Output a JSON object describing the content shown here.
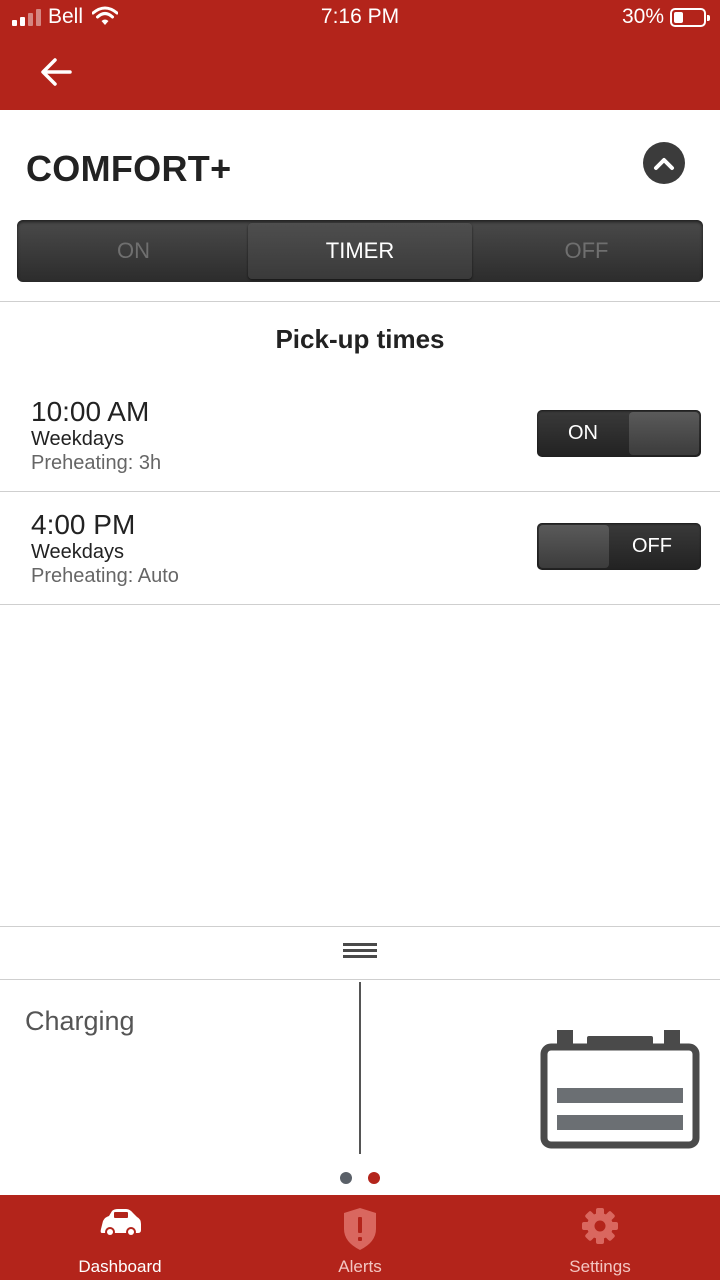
{
  "status_bar": {
    "carrier": "Bell",
    "time": "7:16 PM",
    "battery_percent": "30%"
  },
  "comfort": {
    "title": "COMFORT+",
    "modes": [
      {
        "label": "ON",
        "active": false
      },
      {
        "label": "TIMER",
        "active": true
      },
      {
        "label": "OFF",
        "active": false
      }
    ]
  },
  "pickup": {
    "title": "Pick-up times",
    "items": [
      {
        "time": "10:00 AM",
        "days": "Weekdays",
        "preheating": "Preheating: 3h",
        "toggle": "ON"
      },
      {
        "time": "4:00 PM",
        "days": "Weekdays",
        "preheating": "Preheating: Auto",
        "toggle": "OFF"
      }
    ]
  },
  "charging": {
    "label": "Charging"
  },
  "pager": {
    "count": 2,
    "active_index": 1
  },
  "tabs": [
    {
      "label": "Dashboard",
      "icon": "car-icon",
      "active": true
    },
    {
      "label": "Alerts",
      "icon": "shield-alert-icon",
      "active": false
    },
    {
      "label": "Settings",
      "icon": "gear-icon",
      "active": false
    }
  ],
  "colors": {
    "brand_red": "#b3241b",
    "dark_control": "#2c2c2c",
    "pager_active": "#b3241b",
    "pager_inactive": "#5a6068"
  }
}
